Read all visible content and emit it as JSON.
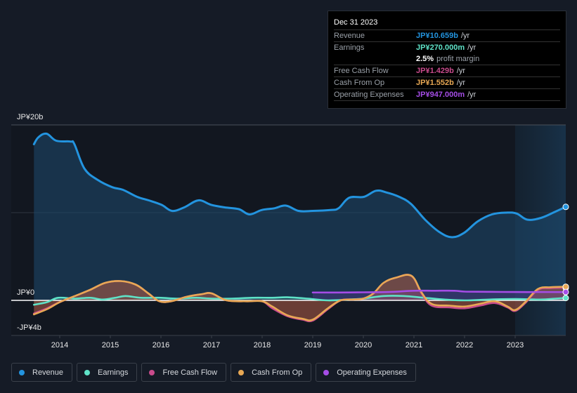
{
  "tooltip": {
    "date": "Dec 31 2023",
    "rows": [
      {
        "label": "Revenue",
        "value": "JP¥10.659b",
        "unit": "/yr",
        "color": "#2394df"
      },
      {
        "label": "Earnings",
        "value": "JP¥270.000m",
        "unit": "/yr",
        "color": "#5fe3c8"
      },
      {
        "label": "Free Cash Flow",
        "value": "JP¥1.429b",
        "unit": "/yr",
        "color": "#c94b8c"
      },
      {
        "label": "Cash From Op",
        "value": "JP¥1.552b",
        "unit": "/yr",
        "color": "#e8a854"
      },
      {
        "label": "Operating Expenses",
        "value": "JP¥947.000m",
        "unit": "/yr",
        "color": "#a54de6"
      }
    ],
    "profit_margin_value": "2.5%",
    "profit_margin_text": "profit margin"
  },
  "legend": [
    {
      "label": "Revenue",
      "color": "#2394df"
    },
    {
      "label": "Earnings",
      "color": "#5fe3c8"
    },
    {
      "label": "Free Cash Flow",
      "color": "#c94b8c"
    },
    {
      "label": "Cash From Op",
      "color": "#e8a854"
    },
    {
      "label": "Operating Expenses",
      "color": "#a54de6"
    }
  ],
  "chart_data": {
    "type": "area",
    "title": "",
    "xlabel": "",
    "ylabel": "",
    "unit": "JP¥ billions",
    "xlim": [
      2013.49,
      2024.0
    ],
    "ylim": [
      -4,
      20
    ],
    "y_ticks": [
      {
        "value": 20,
        "label": "JP¥20b"
      },
      {
        "value": 0,
        "label": "JP¥0"
      },
      {
        "value": -4,
        "label": "-JP¥4b"
      }
    ],
    "x_ticks": [
      2014,
      2015,
      2016,
      2017,
      2018,
      2019,
      2020,
      2021,
      2022,
      2023
    ],
    "x_tick_labels": [
      "2014",
      "2015",
      "2016",
      "2017",
      "2018",
      "2019",
      "2020",
      "2021",
      "2022",
      "2023"
    ],
    "highlight_region": [
      2023.0,
      2024.0
    ],
    "grid": true,
    "legend_position": "bottom",
    "series": [
      {
        "name": "Revenue",
        "color": "#2394df",
        "points": [
          [
            2013.49,
            17.8
          ],
          [
            2013.58,
            18.6
          ],
          [
            2013.74,
            19.0
          ],
          [
            2013.93,
            18.2
          ],
          [
            2014.21,
            18.1
          ],
          [
            2014.29,
            17.8
          ],
          [
            2014.49,
            15.0
          ],
          [
            2014.76,
            13.7
          ],
          [
            2015.04,
            12.9
          ],
          [
            2015.25,
            12.6
          ],
          [
            2015.53,
            11.8
          ],
          [
            2015.76,
            11.4
          ],
          [
            2016.01,
            10.9
          ],
          [
            2016.22,
            10.2
          ],
          [
            2016.46,
            10.6
          ],
          [
            2016.74,
            11.4
          ],
          [
            2016.99,
            10.9
          ],
          [
            2017.26,
            10.6
          ],
          [
            2017.54,
            10.4
          ],
          [
            2017.75,
            9.8
          ],
          [
            2017.99,
            10.3
          ],
          [
            2018.24,
            10.5
          ],
          [
            2018.47,
            10.8
          ],
          [
            2018.72,
            10.2
          ],
          [
            2019.0,
            10.2
          ],
          [
            2019.35,
            10.3
          ],
          [
            2019.51,
            10.5
          ],
          [
            2019.72,
            11.7
          ],
          [
            2020.01,
            11.8
          ],
          [
            2020.25,
            12.5
          ],
          [
            2020.46,
            12.3
          ],
          [
            2020.71,
            11.8
          ],
          [
            2020.94,
            11.0
          ],
          [
            2021.22,
            9.2
          ],
          [
            2021.5,
            7.8
          ],
          [
            2021.75,
            7.2
          ],
          [
            2021.99,
            7.7
          ],
          [
            2022.26,
            9.0
          ],
          [
            2022.54,
            9.8
          ],
          [
            2022.82,
            10.0
          ],
          [
            2023.03,
            9.9
          ],
          [
            2023.24,
            9.2
          ],
          [
            2023.51,
            9.4
          ],
          [
            2023.79,
            10.1
          ],
          [
            2024.0,
            10.659
          ]
        ]
      },
      {
        "name": "Earnings",
        "color": "#5fe3c8",
        "points": [
          [
            2013.49,
            -0.5
          ],
          [
            2013.75,
            -0.2
          ],
          [
            2013.97,
            0.3
          ],
          [
            2014.3,
            0.2
          ],
          [
            2014.6,
            0.3
          ],
          [
            2014.85,
            0.1
          ],
          [
            2015.1,
            0.3
          ],
          [
            2015.3,
            0.5
          ],
          [
            2015.6,
            0.3
          ],
          [
            2016.0,
            0.3
          ],
          [
            2016.3,
            0.2
          ],
          [
            2016.7,
            0.3
          ],
          [
            2017.0,
            0.2
          ],
          [
            2017.4,
            0.2
          ],
          [
            2017.8,
            0.3
          ],
          [
            2018.2,
            0.3
          ],
          [
            2018.5,
            0.35
          ],
          [
            2018.9,
            0.2
          ],
          [
            2019.3,
            0.0
          ],
          [
            2019.7,
            0.1
          ],
          [
            2020.0,
            0.2
          ],
          [
            2020.4,
            0.5
          ],
          [
            2020.8,
            0.5
          ],
          [
            2021.2,
            0.3
          ],
          [
            2021.6,
            0.1
          ],
          [
            2022.0,
            0.0
          ],
          [
            2022.5,
            0.1
          ],
          [
            2023.0,
            0.15
          ],
          [
            2023.5,
            0.1
          ],
          [
            2023.8,
            0.2
          ],
          [
            2024.0,
            0.27
          ]
        ]
      },
      {
        "name": "Free Cash Flow",
        "color": "#c94b8c",
        "points": [
          [
            2013.49,
            -1.5
          ],
          [
            2013.75,
            -0.9
          ],
          [
            2014.0,
            -0.2
          ],
          [
            2014.3,
            0.5
          ],
          [
            2014.6,
            1.2
          ],
          [
            2014.9,
            2.0
          ],
          [
            2015.2,
            2.2
          ],
          [
            2015.5,
            1.8
          ],
          [
            2015.75,
            0.8
          ],
          [
            2015.97,
            -0.1
          ],
          [
            2016.2,
            -0.1
          ],
          [
            2016.5,
            0.4
          ],
          [
            2016.8,
            0.7
          ],
          [
            2017.0,
            0.8
          ],
          [
            2017.3,
            0.0
          ],
          [
            2017.7,
            -0.1
          ],
          [
            2018.0,
            -0.1
          ],
          [
            2018.2,
            -0.9
          ],
          [
            2018.5,
            -1.8
          ],
          [
            2018.8,
            -2.2
          ],
          [
            2019.0,
            -2.3
          ],
          [
            2019.3,
            -1.0
          ],
          [
            2019.55,
            0.0
          ],
          [
            2019.8,
            0.1
          ],
          [
            2020.0,
            0.2
          ],
          [
            2020.2,
            0.8
          ],
          [
            2020.4,
            2.0
          ],
          [
            2020.65,
            2.6
          ],
          [
            2020.95,
            2.8
          ],
          [
            2021.15,
            0.8
          ],
          [
            2021.35,
            -0.6
          ],
          [
            2021.7,
            -0.8
          ],
          [
            2022.0,
            -0.9
          ],
          [
            2022.3,
            -0.6
          ],
          [
            2022.6,
            -0.3
          ],
          [
            2022.85,
            -0.8
          ],
          [
            2023.0,
            -1.2
          ],
          [
            2023.2,
            -0.3
          ],
          [
            2023.45,
            1.2
          ],
          [
            2023.7,
            1.4
          ],
          [
            2024.0,
            1.429
          ]
        ]
      },
      {
        "name": "Cash From Op",
        "color": "#e8a854",
        "points": [
          [
            2013.49,
            -1.6
          ],
          [
            2013.75,
            -1.0
          ],
          [
            2014.0,
            -0.2
          ],
          [
            2014.3,
            0.5
          ],
          [
            2014.6,
            1.2
          ],
          [
            2014.9,
            2.0
          ],
          [
            2015.2,
            2.2
          ],
          [
            2015.5,
            1.8
          ],
          [
            2015.75,
            0.8
          ],
          [
            2015.97,
            -0.1
          ],
          [
            2016.2,
            -0.1
          ],
          [
            2016.5,
            0.4
          ],
          [
            2016.8,
            0.7
          ],
          [
            2017.0,
            0.8
          ],
          [
            2017.3,
            0.0
          ],
          [
            2017.7,
            -0.1
          ],
          [
            2018.0,
            -0.1
          ],
          [
            2018.2,
            -0.7
          ],
          [
            2018.5,
            -1.7
          ],
          [
            2018.8,
            -2.1
          ],
          [
            2019.0,
            -2.2
          ],
          [
            2019.3,
            -0.9
          ],
          [
            2019.55,
            0.0
          ],
          [
            2019.8,
            0.1
          ],
          [
            2020.0,
            0.2
          ],
          [
            2020.2,
            0.8
          ],
          [
            2020.4,
            2.0
          ],
          [
            2020.65,
            2.6
          ],
          [
            2020.95,
            2.8
          ],
          [
            2021.15,
            0.9
          ],
          [
            2021.35,
            -0.4
          ],
          [
            2021.7,
            -0.6
          ],
          [
            2022.0,
            -0.7
          ],
          [
            2022.3,
            -0.4
          ],
          [
            2022.6,
            -0.1
          ],
          [
            2022.85,
            -0.7
          ],
          [
            2023.0,
            -1.1
          ],
          [
            2023.2,
            -0.2
          ],
          [
            2023.45,
            1.3
          ],
          [
            2023.7,
            1.5
          ],
          [
            2024.0,
            1.552
          ]
        ]
      },
      {
        "name": "Operating Expenses",
        "color": "#a54de6",
        "points": [
          [
            2019.0,
            0.9
          ],
          [
            2019.5,
            0.9
          ],
          [
            2020.0,
            0.92
          ],
          [
            2020.5,
            0.95
          ],
          [
            2021.0,
            1.1
          ],
          [
            2021.4,
            1.1
          ],
          [
            2021.8,
            1.1
          ],
          [
            2022.0,
            1.0
          ],
          [
            2022.5,
            0.98
          ],
          [
            2023.0,
            0.95
          ],
          [
            2023.5,
            0.95
          ],
          [
            2024.0,
            0.947
          ]
        ]
      }
    ]
  }
}
